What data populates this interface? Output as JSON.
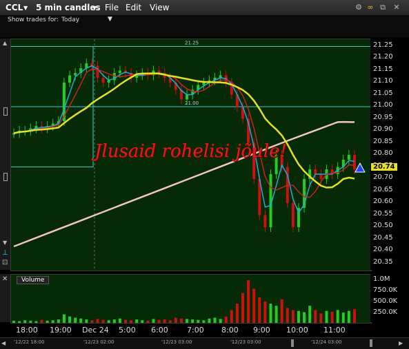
{
  "toolbar": {
    "symbol": "CCL",
    "interval": "5 min candles",
    "menu": [
      "File",
      "Edit",
      "View"
    ],
    "show_trades_label": "Show trades for:",
    "show_trades_value": "Today"
  },
  "overlay_text": "Jlusaid rohelisi jõule!",
  "price_levels": {
    "upper": "21.25",
    "lower": "21.00"
  },
  "last_price": "20.74",
  "colors": {
    "up": "#22cc22",
    "down": "#cc1111",
    "ma_fast": "#cc2222",
    "ma_mid": "#22aadd",
    "ma_slow": "#e8e020",
    "ma_long": "#f0c8c0",
    "hline": "#33cccc",
    "last_price_bg": "#e8e020"
  },
  "volume_label": "Volume",
  "chart_data": {
    "type": "candlestick",
    "price_axis_ticks": [
      "21.25",
      "21.20",
      "21.15",
      "21.10",
      "21.05",
      "21.00",
      "20.95",
      "20.90",
      "20.85",
      "20.80",
      "20.75",
      "20.70",
      "20.65",
      "20.60",
      "20.55",
      "20.50",
      "20.45",
      "20.40",
      "20.35"
    ],
    "ylim": [
      20.32,
      21.28
    ],
    "volume_ticks": [
      "1.0M",
      "750.0K",
      "500.0K",
      "250.0K"
    ],
    "x_ticks": [
      "18:00",
      "19:00",
      "Dec 24",
      "5:00",
      "6:00",
      "7:00",
      "8:00",
      "9:00",
      "10:00",
      "11:00"
    ],
    "scroll_dates": [
      "'12/22 18:00",
      "'12/23 02:00",
      "'12/23 03:00",
      "'12/23 03:00",
      "'12/24 03:00"
    ],
    "close_series": [
      20.89,
      20.9,
      20.9,
      20.91,
      20.92,
      20.91,
      20.92,
      20.93,
      20.94,
      21.1,
      21.13,
      21.14,
      21.16,
      21.18,
      21.17,
      21.12,
      21.1,
      21.11,
      21.14,
      21.15,
      21.14,
      21.12,
      21.13,
      21.14,
      21.13,
      21.15,
      21.14,
      21.12,
      21.1,
      21.07,
      21.03,
      21.05,
      21.07,
      21.09,
      21.1,
      21.11,
      21.12,
      21.13,
      21.1,
      21.05,
      21.0,
      20.95,
      20.85,
      20.7,
      20.55,
      20.5,
      20.72,
      20.8,
      20.75,
      20.6,
      20.5,
      20.58,
      20.7,
      20.74,
      20.72,
      20.7,
      20.74,
      20.72,
      20.75,
      20.78,
      20.8,
      20.74
    ],
    "volume_series": [
      5,
      4,
      6,
      5,
      4,
      7,
      5,
      6,
      8,
      20,
      15,
      12,
      10,
      8,
      6,
      9,
      7,
      6,
      8,
      10,
      7,
      6,
      8,
      6,
      5,
      9,
      7,
      8,
      6,
      12,
      10,
      9,
      8,
      7,
      6,
      10,
      12,
      9,
      15,
      30,
      45,
      70,
      100,
      80,
      60,
      50,
      45,
      40,
      55,
      35,
      30,
      28,
      25,
      40,
      30,
      22,
      28,
      26,
      30,
      24,
      28,
      32
    ]
  }
}
